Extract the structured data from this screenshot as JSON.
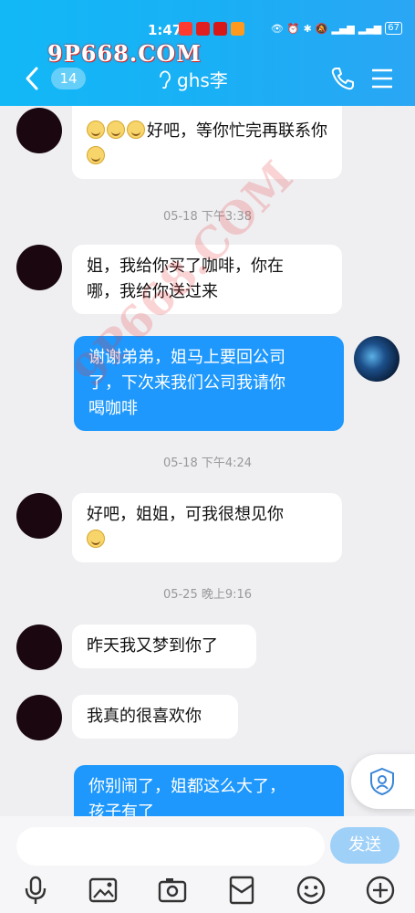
{
  "status_bar": {
    "time": "1:47",
    "battery": "67"
  },
  "watermark_top": "9P668.COM",
  "watermark_diag": "9P668.COM",
  "header": {
    "badge_count": "14",
    "title": "ghs李"
  },
  "messages": {
    "m1": "好吧，等你忙完再联系你",
    "ts1": "05-18 下午3:38",
    "m2_line1": "姐，我给你买了咖啡，你在",
    "m2_line2": "哪，我给你送过来",
    "m3_line1": "谢谢弟弟，姐马上要回公司",
    "m3_line2": "了，下次来我们公司我请你",
    "m3_line3": "喝咖啡",
    "ts2": "05-18 下午4:24",
    "m4": "好吧，姐姐，可我很想见你",
    "ts3": "05-25 晚上9:16",
    "m5": "昨天我又梦到你了",
    "m6": "我真的很喜欢你",
    "m7_line1": "你别闹了，姐都这么大了，",
    "m7_line2": "孩子有了"
  },
  "input": {
    "send_label": "发送"
  },
  "icons": [
    "back-icon",
    "ear-icon",
    "phone-icon",
    "menu-icon",
    "voice-icon",
    "image-icon",
    "camera-icon",
    "red-packet-icon",
    "emoji-icon",
    "plus-icon",
    "shield-icon"
  ]
}
